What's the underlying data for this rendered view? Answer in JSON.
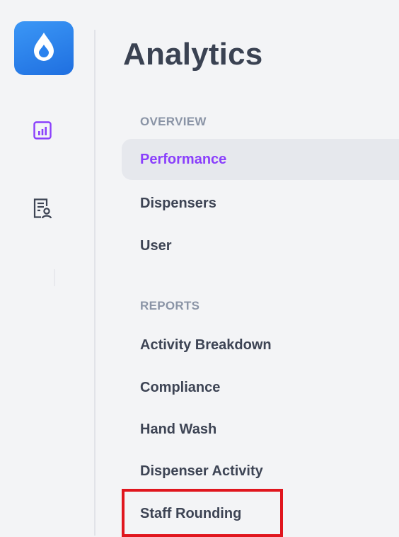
{
  "page": {
    "title": "Analytics"
  },
  "rail": {
    "logo_icon": "droplet-icon",
    "items": [
      {
        "icon": "bar-chart-icon",
        "active": true
      },
      {
        "icon": "report-user-icon",
        "active": false
      }
    ]
  },
  "nav": {
    "sections": [
      {
        "label": "OVERVIEW",
        "items": [
          {
            "label": "Performance",
            "active": true
          },
          {
            "label": "Dispensers"
          },
          {
            "label": "User"
          }
        ]
      },
      {
        "label": "REPORTS",
        "items": [
          {
            "label": "Activity Breakdown"
          },
          {
            "label": "Compliance"
          },
          {
            "label": "Hand Wash"
          },
          {
            "label": "Dispenser Activity"
          },
          {
            "label": "Staff Rounding",
            "highlighted": true
          }
        ]
      }
    ]
  },
  "colors": {
    "accent": "#8a3ffc",
    "logo": "#2a82ee",
    "highlight": "#e0161e",
    "text": "#3d4454",
    "muted": "#8a94a6"
  }
}
